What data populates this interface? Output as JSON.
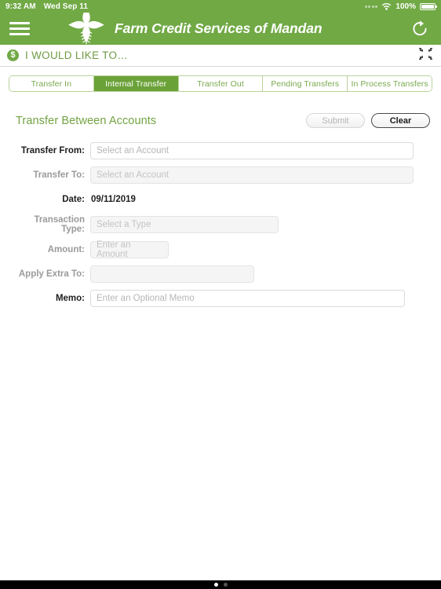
{
  "status_bar": {
    "time": "9:32 AM",
    "date": "Wed Sep 11",
    "battery_percent": "100%",
    "wifi_icon": "wifi-icon",
    "battery_icon": "battery-icon",
    "signal_dots_icon": "signal-dots-icon"
  },
  "app_bar": {
    "menu_icon": "hamburger-menu-icon",
    "logo_icon": "farm-credit-logo-icon",
    "brand_name": "Farm Credit Services of Mandan",
    "refresh_icon": "refresh-icon",
    "background_color": "#71a945"
  },
  "section": {
    "badge_icon": "dollar-badge-icon",
    "badge_label": "$",
    "title": "I WOULD LIKE TO…",
    "collapse_icon": "collapse-icon",
    "title_color": "#6f9b43"
  },
  "tabs": {
    "active_index": 1,
    "active_color": "#6ba238",
    "items": [
      {
        "label": "Transfer In"
      },
      {
        "label": "Internal Transfer"
      },
      {
        "label": "Transfer Out"
      },
      {
        "label": "Pending Transfers"
      },
      {
        "label": "In Process Transfers"
      }
    ]
  },
  "form": {
    "title": "Transfer Between Accounts",
    "submit_label": "Submit",
    "clear_label": "Clear",
    "submit_enabled": false,
    "clear_enabled": true,
    "fields": {
      "transfer_from": {
        "label": "Transfer From:",
        "placeholder": "Select an Account",
        "value": ""
      },
      "transfer_to": {
        "label": "Transfer To:",
        "placeholder": "Select an Account",
        "value": ""
      },
      "date": {
        "label": "Date:",
        "value": "09/11/2019"
      },
      "transaction_type": {
        "label": "Transaction Type:",
        "placeholder": "Select a Type",
        "value": ""
      },
      "amount": {
        "label": "Amount:",
        "placeholder": "Enter an Amount",
        "value": ""
      },
      "apply_extra_to": {
        "label": "Apply Extra To:",
        "placeholder": "",
        "value": ""
      },
      "memo": {
        "label": "Memo:",
        "placeholder": "Enter an Optional Memo",
        "value": ""
      }
    }
  },
  "home_indicator": {
    "dots": 2,
    "active_dot": 0
  }
}
